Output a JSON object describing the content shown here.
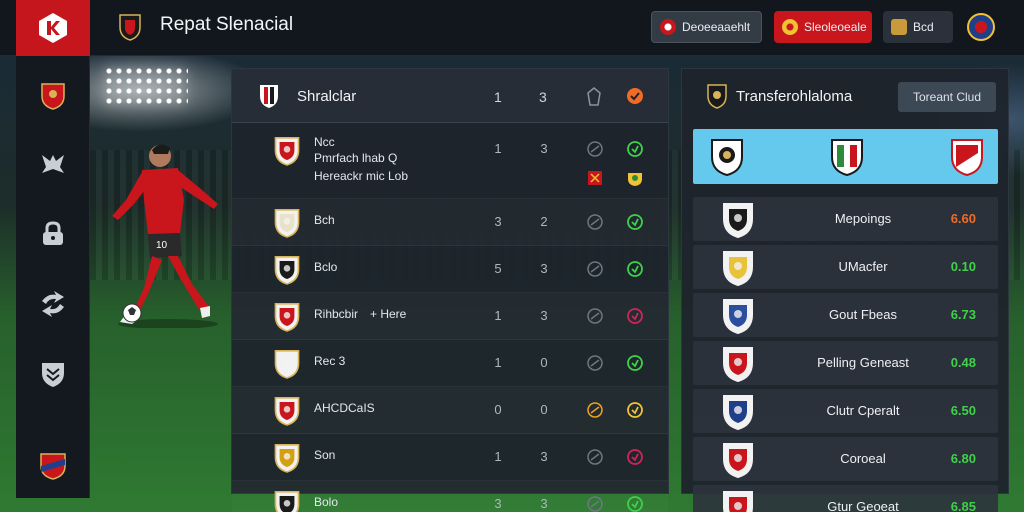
{
  "app": {
    "title": "Repat Slenacial"
  },
  "topbar": {
    "buttons": [
      {
        "label": "Deoeeaaehlt",
        "color": "#333b45"
      },
      {
        "label": "Sleoleoeale",
        "color": "#c8161c"
      },
      {
        "label": "Bcd",
        "color": "#2a313b"
      }
    ]
  },
  "sidebar": {
    "items": [
      {
        "icon": "club-crest-icon"
      },
      {
        "icon": "tactics-icon"
      },
      {
        "icon": "lock-icon"
      },
      {
        "icon": "transfer-icon"
      },
      {
        "icon": "shield-icon"
      },
      {
        "icon": "league-badge-icon"
      }
    ]
  },
  "standings": {
    "title": "Shralclar",
    "header_cols": [
      "1",
      "3"
    ],
    "rows": [
      {
        "name_line1": "Ncc",
        "name_line2": "Pmrfach lhab Q",
        "name_line3": "Hereackr mic Lob",
        "c1": "1",
        "c2": "3",
        "crest_color": "#c8161c"
      },
      {
        "name_line1": "Bch",
        "c1": "3",
        "c2": "2",
        "crest_color": "#e8e2c8"
      },
      {
        "name_line1": "Bclo",
        "c1": "5",
        "c2": "3",
        "crest_color": "#1a1a1a"
      },
      {
        "name_line1": "Rihbcbir",
        "name_extra": "+ Here",
        "c1": "1",
        "c2": "3",
        "crest_color": "#c8161c"
      },
      {
        "name_line1": "Rec 3",
        "c1": "1",
        "c2": "0",
        "crest_color": "#f2f2f2"
      },
      {
        "name_line1": "AHCDCaIS",
        "c1": "0",
        "c2": "0",
        "crest_color": "#c8161c"
      },
      {
        "name_line1": "Son",
        "c1": "1",
        "c2": "3",
        "crest_color": "#d4a012"
      },
      {
        "name_line1": "Bolo",
        "c1": "3",
        "c2": "3",
        "crest_color": "#1a1a1a"
      }
    ]
  },
  "transfers": {
    "title": "Transferohlaloma",
    "button_label": "Toreant Clud",
    "featured": [
      {
        "crest_color": "#1a1a1a"
      },
      {
        "crest_color": "#2e8b3c"
      },
      {
        "crest_color": "#c8161c"
      }
    ],
    "rows": [
      {
        "name": "Mepoings",
        "fee": "6.60",
        "fee_color": "#f26b24",
        "crest_color": "#1a1a1a"
      },
      {
        "name": "UMacfer",
        "fee": "0.10",
        "fee_color": "#3fd14a",
        "crest_color": "#e8c23a"
      },
      {
        "name": "Gout Fbeas",
        "fee": "6.73",
        "fee_color": "#3fd14a",
        "crest_color": "#2b4f9e"
      },
      {
        "name": "Pelling Geneast",
        "fee": "0.48",
        "fee_color": "#3fd14a",
        "crest_color": "#c8161c"
      },
      {
        "name": "Clutr Cperalt",
        "fee": "6.50",
        "fee_color": "#3fd14a",
        "crest_color": "#1f3f8a"
      },
      {
        "name": "Coroeal",
        "fee": "6.80",
        "fee_color": "#3fd14a",
        "crest_color": "#c8161c"
      },
      {
        "name": "Gtur Geoeat",
        "fee": "6.85",
        "fee_color": "#3fd14a",
        "crest_color": "#c8161c"
      }
    ]
  }
}
